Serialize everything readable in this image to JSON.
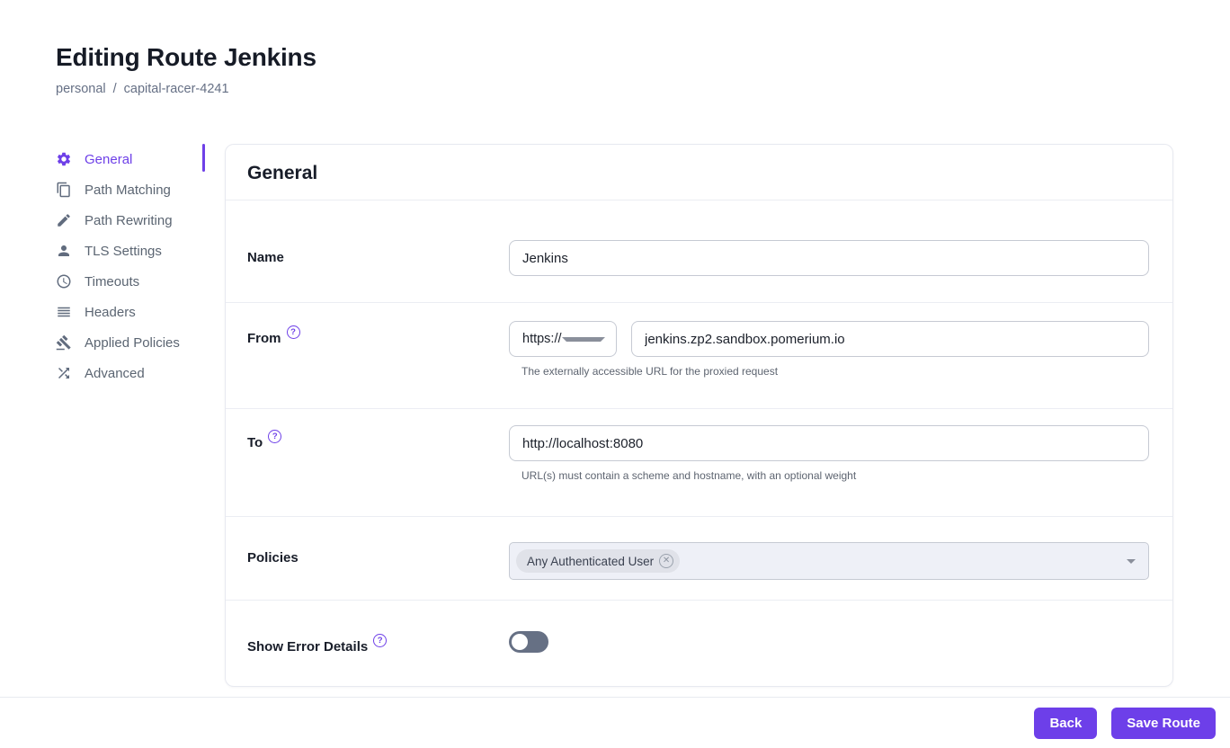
{
  "page": {
    "title": "Editing Route Jenkins",
    "breadcrumb": {
      "items": [
        "personal",
        "capital-racer-4241"
      ],
      "separator": "/"
    }
  },
  "colors": {
    "accent": "#6e40e8",
    "toggle_track_off": "#667084",
    "policies_fill": "#eef0f7"
  },
  "sidebar": {
    "items": [
      {
        "label": "General",
        "icon": "gear-icon",
        "selected": true
      },
      {
        "label": "Path Matching",
        "icon": "copy-icon",
        "selected": false
      },
      {
        "label": "Path Rewriting",
        "icon": "pencil-icon",
        "selected": false
      },
      {
        "label": "TLS Settings",
        "icon": "person-icon",
        "selected": false
      },
      {
        "label": "Timeouts",
        "icon": "clock-icon",
        "selected": false
      },
      {
        "label": "Headers",
        "icon": "lines-icon",
        "selected": false
      },
      {
        "label": "Applied Policies",
        "icon": "gavel-icon",
        "selected": false
      },
      {
        "label": "Advanced",
        "icon": "shuffle-icon",
        "selected": false
      }
    ]
  },
  "card": {
    "title": "General",
    "fields": {
      "name": {
        "label": "Name",
        "value": "Jenkins"
      },
      "from": {
        "label": "From",
        "scheme": "https://",
        "value": "jenkins.zp2.sandbox.pomerium.io",
        "helper": "The externally accessible URL for the proxied request"
      },
      "to": {
        "label": "To",
        "value": "http://localhost:8080",
        "helper": "URL(s) must contain a scheme and hostname, with an optional weight"
      },
      "policies": {
        "label": "Policies",
        "chips": [
          "Any Authenticated User"
        ]
      },
      "show_error_details": {
        "label": "Show Error Details",
        "enabled": false
      }
    },
    "help_glyph": "?",
    "chip_delete_glyph": "✕"
  },
  "footer": {
    "back_label": "Back",
    "save_label": "Save Route"
  }
}
